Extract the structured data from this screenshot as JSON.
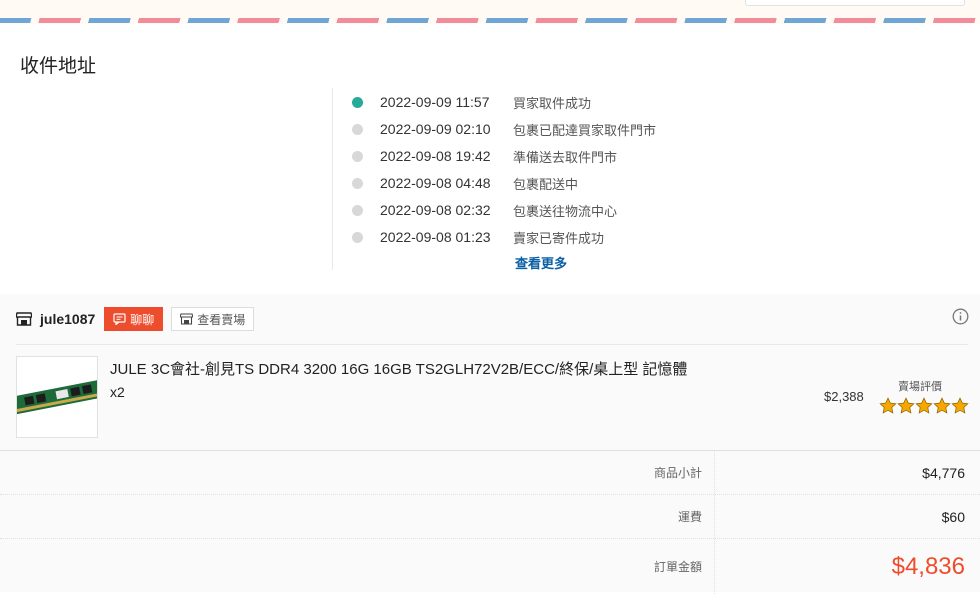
{
  "address_section": {
    "title": "收件地址"
  },
  "timeline": [
    {
      "time": "2022-09-09 11:57",
      "desc": "買家取件成功",
      "active": true
    },
    {
      "time": "2022-09-09 02:10",
      "desc": "包裹已配達買家取件門市",
      "active": false
    },
    {
      "time": "2022-09-08 19:42",
      "desc": "準備送去取件門市",
      "active": false
    },
    {
      "time": "2022-09-08 04:48",
      "desc": "包裹配送中",
      "active": false
    },
    {
      "time": "2022-09-08 02:32",
      "desc": "包裹送往物流中心",
      "active": false
    },
    {
      "time": "2022-09-08 01:23",
      "desc": "賣家已寄件成功",
      "active": false
    }
  ],
  "see_more_label": "查看更多",
  "shop": {
    "name": "jule1087",
    "chat_label": "聊聊",
    "view_shop_label": "查看賣場"
  },
  "product": {
    "name": "JULE 3C會社-創見TS DDR4 3200 16G 16GB TS2GLH72V2B/ECC/終保/桌上型 記憶體",
    "quantity": "x2",
    "price": "$2,388",
    "rating_label": "賣場評價",
    "rating_stars": 5
  },
  "totals": {
    "subtotal_label": "商品小計",
    "subtotal_value": "$4,776",
    "shipping_label": "運費",
    "shipping_value": "$60",
    "total_label": "訂單金額",
    "total_value": "$4,836"
  },
  "colors": {
    "accent": "#ee4d2d",
    "active_dot": "#26aa99",
    "link": "#0b5fa5",
    "star": "#f6a700"
  }
}
